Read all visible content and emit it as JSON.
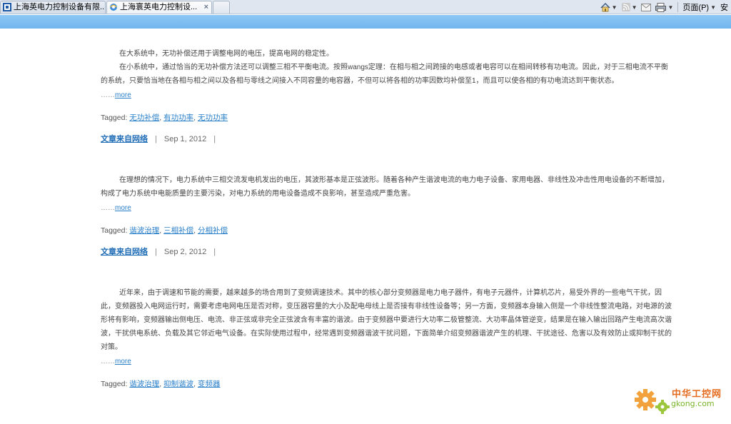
{
  "browser": {
    "tabs": [
      {
        "label": "上海英电力控制设备有限..."
      },
      {
        "label": "上海寰英电力控制设..."
      }
    ],
    "close_glyph": "×",
    "menu_page": "页面(P)",
    "menu_safety": "安"
  },
  "posts": [
    {
      "paragraphs": [
        "在大系统中，无功补偿还用于调整电网的电压，提高电网的稳定性。",
        "在小系统中，通过恰当的无功补偿方法还可以调整三相不平衡电流。按照wangs定理：在相与相之间跨接的电感或者电容可以在相间转移有功电流。因此，对于三相电流不平衡的系统，只要恰当地在各相与相之间以及各相与零线之间接入不同容量的电容器，不但可以将各相的功率因数均补偿至1，而且可以使各相的有功电流达到平衡状态。"
      ],
      "ellipsis": "……",
      "more": "more",
      "tagged_label": "Tagged:",
      "tags": [
        "无功补偿",
        "有功功率",
        "无功功率"
      ],
      "author": "文章来自网络",
      "date": "Sep 1, 2012"
    },
    {
      "paragraphs": [
        "在理想的情况下，电力系统中三相交流发电机发出的电压，其波形基本是正弦波形。随着各种产生谐波电流的电力电子设备、家用电器、非线性及冲击性用电设备的不断增加，构成了电力系统中电能质量的主要污染，对电力系统的用电设备造成不良影响，甚至造成严重危害。"
      ],
      "ellipsis": "……",
      "more": "more",
      "tagged_label": "Tagged:",
      "tags": [
        "谐波治理",
        "三相补偿",
        "分相补偿"
      ],
      "author": "文章来自网络",
      "date": "Sep 2, 2012"
    },
    {
      "paragraphs": [
        "近年来，由于调速和节能的需要，越来越多的场合用到了变频调速技术。其中的核心部分变频器是电力电子器件，有电子元器件，计算机芯片，易受外界的一些电气干扰，因此，变频器投入电网运行时，需要考虑电网电压是否对称，变压器容量的大小及配电母线上是否接有非线性设备等；另一方面，变频器本身输入侧是一个非线性整流电路，对电源的波形将有影响，变频器输出侧电压、电流、非正弦或非完全正弦波含有丰富的谐波。由于变频器中要进行大功率二极管整流、大功率晶体管逆变，结果是在输入输出回路产生电流高次谐波，干扰供电系统、负载及其它邻近电气设备。在实际使用过程中，经常遇到变频器谐波干扰问题，下面简单介绍变频器谐波产生的机理、干扰途径、危害以及有效防止或抑制干扰的对策。"
      ],
      "ellipsis": "……",
      "more": "more",
      "tagged_label": "Tagged:",
      "tags": [
        "谐波治理",
        "抑制谐波",
        "变频器"
      ]
    }
  ],
  "watermark": {
    "line1": "中华工控网",
    "line2": "gkong.com"
  }
}
